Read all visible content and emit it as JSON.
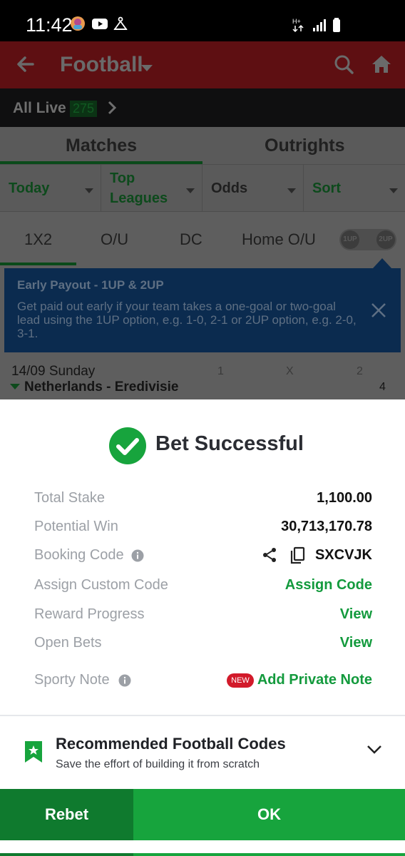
{
  "status_bar": {
    "time": "11:42",
    "icons": [
      "avatar-icon",
      "youtube-icon",
      "notification-icon",
      "data-icon",
      "signal-icon",
      "battery-icon"
    ]
  },
  "header": {
    "title": "Football",
    "icons": [
      "back-arrow-icon",
      "caret-down-icon",
      "search-icon",
      "home-icon"
    ]
  },
  "live": {
    "label": "All Live",
    "count": "275"
  },
  "tabs": {
    "matches": "Matches",
    "outrights": "Outrights"
  },
  "filters": {
    "today": "Today",
    "top_leagues_1": "Top",
    "top_leagues_2": "Leagues",
    "odds": "Odds",
    "sort": "Sort"
  },
  "markets": {
    "m1x2": "1X2",
    "ou": "O/U",
    "dc": "DC",
    "home_ou": "Home O/U",
    "toggle_1": "1UP",
    "toggle_2": "2UP"
  },
  "early_payout": {
    "title": "Early Payout - 1UP & 2UP",
    "body": "Get paid out early if your team takes a one-goal or two-goal lead using the 1UP option, e.g. 1-0, 2-1 or 2UP option, e.g. 2-0, 3-1."
  },
  "match_list": {
    "date": "14/09 Sunday",
    "col_1": "1",
    "col_x": "X",
    "col_2": "2",
    "league": "Netherlands - Eredivisie",
    "count": "4"
  },
  "bet_sheet": {
    "title": "Bet Successful",
    "total_stake_label": "Total Stake",
    "total_stake_value": "1,100.00",
    "potential_win_label": "Potential Win",
    "potential_win_value": "30,713,170.78",
    "booking_code_label": "Booking Code",
    "booking_code_value": "SXCVJK",
    "assign_code_label": "Assign Custom Code",
    "assign_code_action": "Assign Code",
    "reward_label": "Reward Progress",
    "reward_action": "View",
    "open_bets_label": "Open Bets",
    "open_bets_action": "View",
    "note_label": "Sporty Note",
    "new_badge": "NEW",
    "note_action": "Add Private Note"
  },
  "recommended": {
    "title": "Recommended Football Codes",
    "subtitle": "Save the effort of building it from scratch"
  },
  "buttons": {
    "rebet": "Rebet",
    "ok": "OK"
  },
  "colors": {
    "brand_green": "#17a43d",
    "dark_green": "#0f7a2e",
    "link_green": "#139a3d",
    "badge_red": "#d21a2a"
  }
}
